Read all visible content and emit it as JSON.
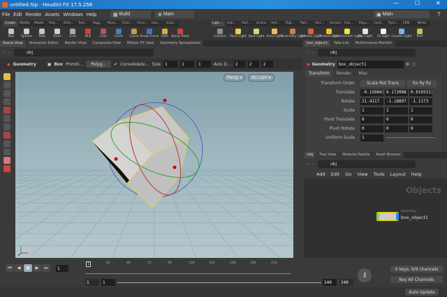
{
  "window": {
    "title": "untitled.hip - Houdini FX 17.5.258",
    "minimize": "—",
    "maximize": "☐",
    "close": "✕"
  },
  "menu": {
    "items": [
      "File",
      "Edit",
      "Render",
      "Assets",
      "Windows",
      "Help"
    ],
    "desktop": "Build",
    "context": "Main",
    "context2": "Main"
  },
  "shelf_left": {
    "tabs": [
      "Create",
      "Modify",
      "Model",
      "Poly…",
      "Defo…",
      "Text…",
      "Rigg…",
      "Musc…",
      "Char…",
      "Cons…",
      "Hair…",
      "Guid…"
    ],
    "tools": [
      {
        "label": "Box",
        "color": "#bfc8d0"
      },
      {
        "label": "Sphere",
        "color": "#d0d0d0"
      },
      {
        "label": "Tube",
        "color": "#c0c8d0"
      },
      {
        "label": "Torus",
        "color": "#c8d0d8"
      },
      {
        "label": "Grid",
        "color": "#aaaaaa"
      },
      {
        "label": "Null",
        "color": "#d04040"
      },
      {
        "label": "Line",
        "color": "#c05050"
      },
      {
        "label": "Circle",
        "color": "#4080c0"
      },
      {
        "label": "Curve",
        "color": "#c0a040"
      },
      {
        "label": "Draw Curve",
        "color": "#4070d0"
      },
      {
        "label": "Path",
        "color": "#d0b040"
      },
      {
        "label": "Spray Paint",
        "color": "#d04040"
      }
    ]
  },
  "shelf_right": {
    "tabs": [
      "Ligh…",
      "Coll…",
      "Part…",
      "Grains",
      "Vell…",
      "Rigi…",
      "Part…",
      "Visc…",
      "Oceans",
      "Flui…",
      "Popu…",
      "Cont…",
      "Pyro…",
      "FEM",
      "Wires"
    ],
    "tools": [
      {
        "label": "Camera",
        "color": "#8090a0"
      },
      {
        "label": "Point Light",
        "color": "#f0d040"
      },
      {
        "label": "Spot Light",
        "color": "#e0d080"
      },
      {
        "label": "Area Light",
        "color": "#e0c060"
      },
      {
        "label": "Geometry Light",
        "color": "#d08040"
      },
      {
        "label": "Volume Light",
        "color": "#e06030"
      },
      {
        "label": "Distant Light",
        "color": "#f0c030"
      },
      {
        "label": "Environment Light",
        "color": "#f0e040"
      },
      {
        "label": "Sky Light",
        "color": "#e0e0f0"
      },
      {
        "label": "GI Light",
        "color": "#f0f0f0"
      },
      {
        "label": "Caustic Light",
        "color": "#80b0e0"
      },
      {
        "label": "Port",
        "color": "#d0c040"
      }
    ]
  },
  "left_pane": {
    "tabs": [
      "Scene View",
      "Animation Editor",
      "Render View",
      "Composite View",
      "Motion FX View",
      "Geometry Spreadsheet"
    ],
    "path": "obj",
    "toolbar": {
      "context": "Geometry",
      "node": "Box",
      "primitive": "Primiti…",
      "type": "Polyg…",
      "consolidate": "Consolidate…",
      "size_label": "Size",
      "size": [
        "1",
        "1",
        "1"
      ],
      "axis_label": "Axis D…",
      "axis": [
        "2",
        "2",
        "2"
      ]
    },
    "viewport": {
      "persp": "Persp ▾",
      "cam": "No cam ▾"
    }
  },
  "right_pane": {
    "tabs": [
      "box_object1",
      "Take List",
      "Performance Monitor"
    ],
    "path": "obj",
    "params": {
      "context": "Geometry",
      "name": "box_object1",
      "tabs": [
        "Transform",
        "Render",
        "Misc"
      ],
      "transform_order_label": "Transform Order",
      "transform_order": "Scale Rot Trans",
      "rot_order": "Rx Ry Rz",
      "rows": [
        {
          "label": "Translate",
          "values": [
            "-0.150843",
            "0.172088",
            "0.0103313"
          ]
        },
        {
          "label": "Rotate",
          "values": [
            "21.4117",
            "-1.18897",
            "-1.1173"
          ]
        },
        {
          "label": "Scale",
          "values": [
            "1",
            "1",
            "1"
          ]
        },
        {
          "label": "Pivot Translate",
          "values": [
            "0",
            "0",
            "0"
          ]
        },
        {
          "label": "Pivot Rotate",
          "values": [
            "0",
            "0",
            "0"
          ]
        }
      ],
      "uniform_scale_label": "Uniform Scale",
      "uniform_scale": "1",
      "uniform_scale_fraction": 1.0
    }
  },
  "network": {
    "tabs": [
      "/obj",
      "Tree View",
      "Material Palette",
      "Asset Browser"
    ],
    "path": "obj",
    "menu": [
      "Add",
      "Edit",
      "Go",
      "View",
      "Tools",
      "Layout",
      "Help"
    ],
    "title": "Objects",
    "node": {
      "type": "Geometry",
      "name": "box_object1"
    }
  },
  "timeline": {
    "frame": "1",
    "ticks": [
      "1",
      "24",
      "48",
      "72",
      "96",
      "120",
      "144",
      "168",
      "192",
      "216"
    ],
    "current_frame": "1",
    "start": "1",
    "range_start": "1",
    "range_end": "240",
    "end": "240",
    "keys": "0 keys, 9/9 channels",
    "key_all": "Key All Channels",
    "auto_update": "Auto Update"
  }
}
